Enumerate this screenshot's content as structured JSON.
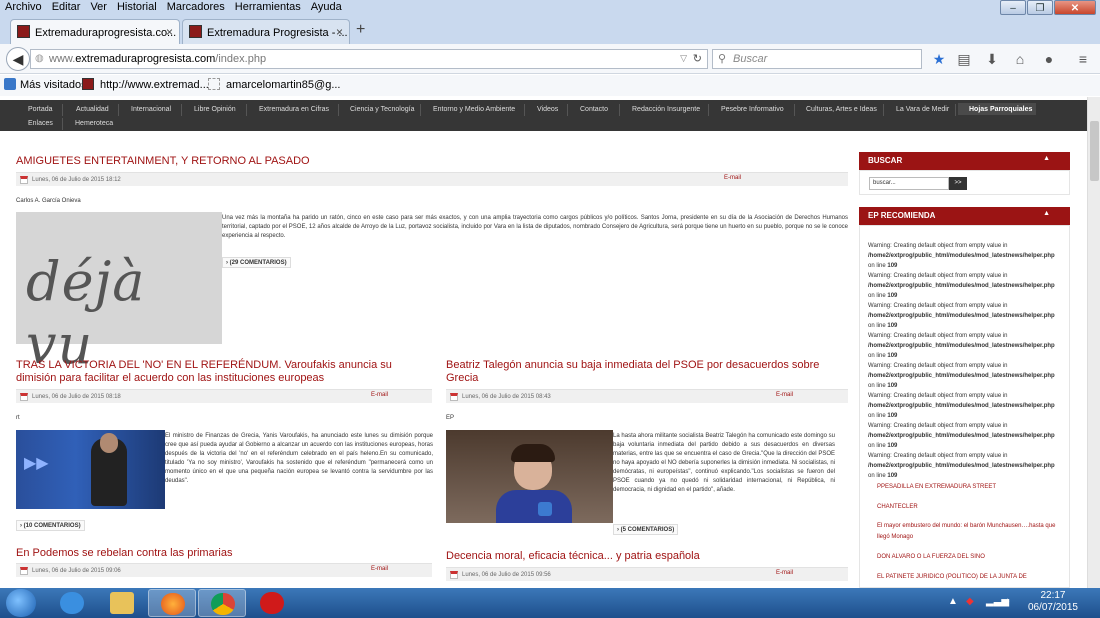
{
  "menu": [
    "Archivo",
    "Editar",
    "Ver",
    "Historial",
    "Marcadores",
    "Herramientas",
    "Ayuda"
  ],
  "tabs": [
    {
      "label": "Extremaduraprogresista.co...",
      "close": "×"
    },
    {
      "label": "Extremadura Progresista - ...",
      "close": "×"
    },
    {
      "label": "+"
    }
  ],
  "url": {
    "prefix": "www.",
    "host": "extremaduraprogresista.com",
    "path": "/index.php"
  },
  "search_placeholder": "Buscar",
  "bookmarks": [
    "Más visitados",
    "http://www.extremad...",
    "amarcelomartin85@g..."
  ],
  "nav_row1": [
    "Portada",
    "Actualidad",
    "Internacional",
    "Libre Opinión",
    "Extremadura en Cifras",
    "Ciencia y Tecnología",
    "Entorno y Medio Ambiente",
    "Videos",
    "Contacto",
    "Redacción Insurgente",
    "Pesebre Informativo",
    "Culturas, Artes e Ideas",
    "La Vara de Medir",
    "Hojas Parroquiales"
  ],
  "nav_row2": [
    "Enlaces",
    "Hemeroteca"
  ],
  "articles": {
    "a1": {
      "title": "AMIGUETES ENTERTAINMENT, Y RETORNO AL PASADO",
      "date": "Lunes, 06 de Julio de 2015 18:12",
      "email": "E-mail",
      "author": "Carlos A. García Onieva",
      "image_text": "déjà vu",
      "text": "Una vez más la montaña ha parido un ratón, cinco en este caso para ser más exactos, y con una amplia trayectoria como cargos públicos y/o políticos. Santos Jorna, presidente en su día de la Asociación de Derechos Humanos territorial, captado por el PSOE, 12 años alcalde de Arroyo de la Luz, portavoz socialista, incluido por Vara en la lista de diputados, nombrado Consejero de Agricultura, será porque tiene un huerto en su pueblo, porque no se le conoce experiencia al respecto.",
      "comments": "(29 COMENTARIOS)"
    },
    "a2": {
      "title": "TRAS LA VICTORIA DEL 'NO' EN EL REFERÉNDUM. Varoufakis anuncia su dimisión para facilitar el acuerdo con las instituciones europeas",
      "date": "Lunes, 06 de Julio de 2015 08:18",
      "email": "E-mail",
      "author": "rt",
      "text": "El ministro de Finanzas de Grecia, Yanis Varoufakis, ha anunciado este lunes su dimisión porque cree que así pueda ayudar al Gobierno a alcanzar un acuerdo con las instituciones europeas, horas después de la victoria del 'no' en el referéndum celebrado en el país heleno.En su comunicado, titulado 'Ya no soy ministro', Varoufakis ha sostenido que el referéndum \"permanecerá como un momento único en el que una pequeña nación europea se levantó contra la servidumbre por las deudas\".",
      "comments": "(10 COMENTARIOS)"
    },
    "a3": {
      "title": "Beatriz Talegón anuncia su baja inmediata del PSOE por desacuerdos sobre Grecia",
      "date": "Lunes, 06 de Julio de 2015 08:43",
      "email": "E-mail",
      "author": "EP",
      "text": "La hasta ahora militante socialista Beatriz Talegón ha comunicado este domingo su baja voluntaria inmediata del partido debido a sus desacuerdos en diversas materias, entre las que se encuentra el caso de Grecia.\"Que la dirección del PSOE no haya apoyado el NO debería suponerles la dimisión inmediata. Ni socialistas, ni demócratas, ni europeístas\", continuó explicando.\"Los socialistas se fueron del PSOE cuando ya no quedó ni solidaridad internacional, ni República, ni democracia, ni dignidad en el partido\", añade.",
      "comments": "(5 COMENTARIOS)"
    },
    "a4": {
      "title": "En Podemos se rebelan contra las primarias",
      "date": "Lunes, 06 de Julio de 2015 09:06",
      "email": "E-mail"
    },
    "a5": {
      "title": "Decencia moral, eficacia técnica... y patria española",
      "date": "Lunes, 06 de Julio de 2015 09:56",
      "email": "E-mail"
    }
  },
  "sidebar": {
    "search_title": "BUSCAR",
    "search_placeholder": "buscar...",
    "search_go": ">>",
    "rec_title": "EP RECOMIENDA",
    "collapse": "▲",
    "warning_prefix": "Warning: Creating default object from empty value in ",
    "warning_path": "/home2/extprog/public_html/modules/mod_latestnews/helper.php",
    "warning_on_line": " on line ",
    "warning_line": "109",
    "links": [
      "PPESADILLA EN EXTREMADURA STREET",
      "CHANTECLER",
      "El mayor embustero del mundo: el barón Munchausen….hasta que llegó Monago",
      "DON ALVARO O LA FUERZA DEL SINO",
      "EL PATINETE JURIDICO (POLITICO) DE LA JUNTA DE"
    ]
  },
  "clock": {
    "time": "22:17",
    "date": "06/07/2015"
  }
}
